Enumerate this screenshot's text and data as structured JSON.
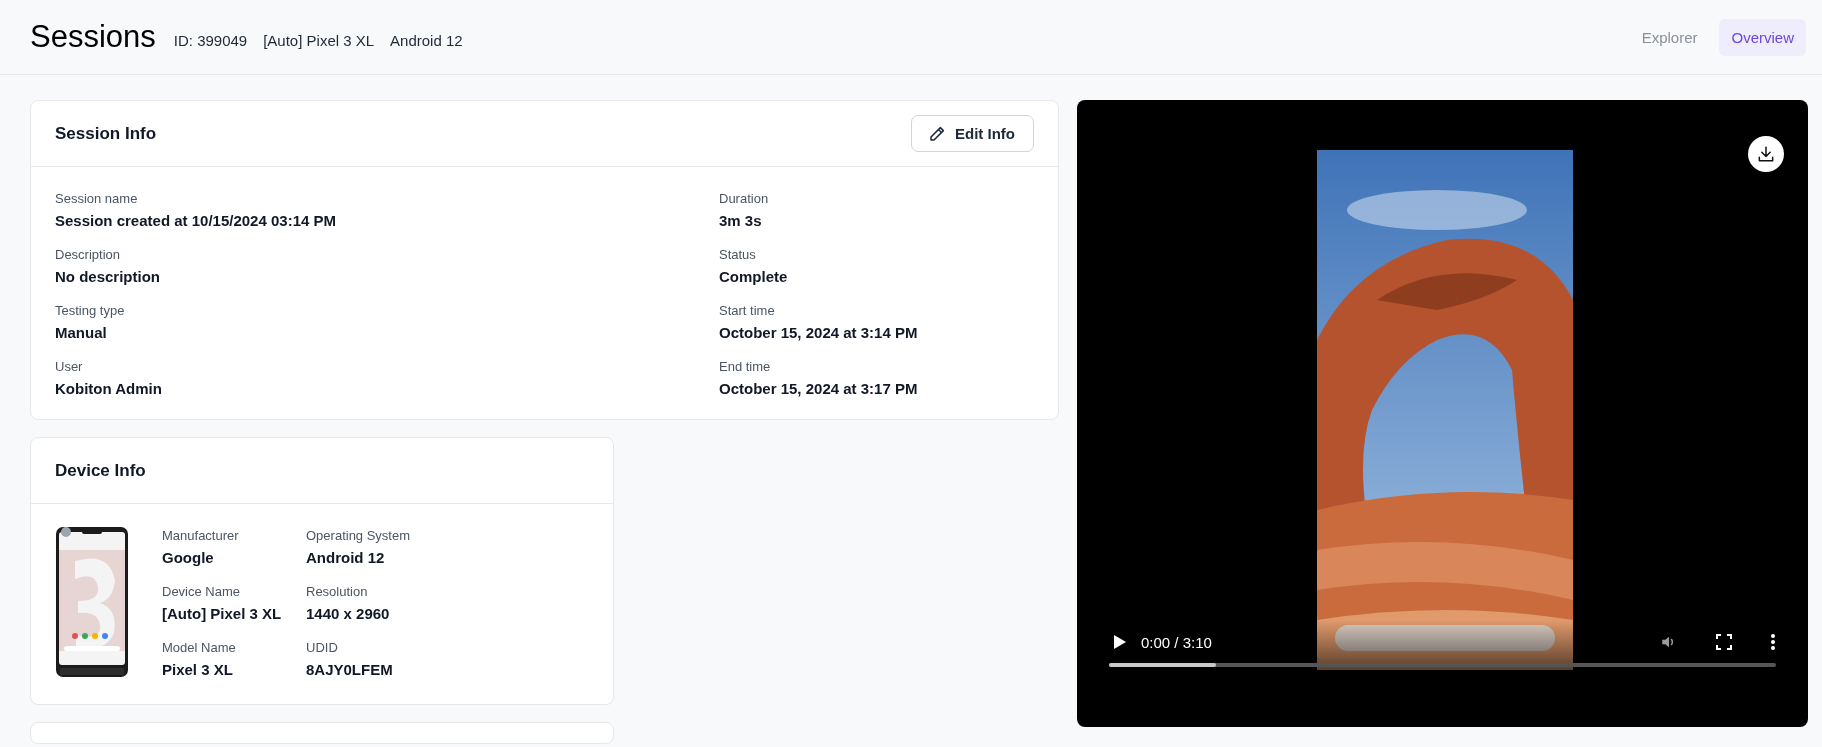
{
  "header": {
    "title": "Sessions",
    "meta": [
      "ID: 399049",
      "[Auto] Pixel 3 XL",
      "Android 12"
    ],
    "tabs": [
      {
        "label": "Explorer",
        "selected": false
      },
      {
        "label": "Overview",
        "selected": true
      }
    ]
  },
  "session_info": {
    "title": "Session Info",
    "edit_button": "Edit Info",
    "fields": [
      {
        "label": "Session name",
        "value": "Session created at 10/15/2024 03:14 PM"
      },
      {
        "label": "Duration",
        "value": "3m 3s"
      },
      {
        "label": "Description",
        "value": "No description"
      },
      {
        "label": "Status",
        "value": "Complete"
      },
      {
        "label": "Testing type",
        "value": "Manual"
      },
      {
        "label": "Start time",
        "value": "October 15, 2024 at 3:14 PM"
      },
      {
        "label": "User",
        "value": "Kobiton Admin"
      },
      {
        "label": "End time",
        "value": "October 15, 2024 at 3:17 PM"
      }
    ]
  },
  "device_info": {
    "title": "Device Info",
    "fields": [
      {
        "label": "Manufacturer",
        "value": "Google"
      },
      {
        "label": "Operating System",
        "value": "Android 12"
      },
      {
        "label": "Device Name",
        "value": "[Auto] Pixel 3 XL"
      },
      {
        "label": "Resolution",
        "value": "1440 x 2960"
      },
      {
        "label": "Model Name",
        "value": "Pixel 3 XL"
      },
      {
        "label": "UDID",
        "value": "8AJY0LFEM"
      }
    ]
  },
  "video": {
    "time": "0:00 / 3:10",
    "progress": {
      "level": 0.16
    }
  }
}
